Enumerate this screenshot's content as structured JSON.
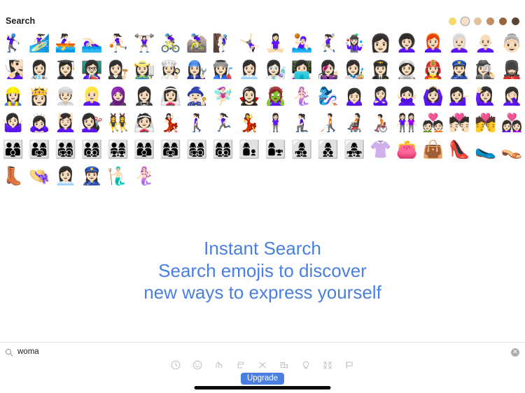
{
  "header": {
    "title": "Search",
    "skin_tones": [
      {
        "name": "default-yellow",
        "color": "#f4d96b",
        "selected": false
      },
      {
        "name": "light-skin-tone",
        "color": "#f6e0c8",
        "selected": true
      },
      {
        "name": "medium-light-skin-tone",
        "color": "#e2c39a",
        "selected": false
      },
      {
        "name": "medium-skin-tone",
        "color": "#bf8f63",
        "selected": false
      },
      {
        "name": "medium-dark-skin-tone",
        "color": "#96653f",
        "selected": false
      },
      {
        "name": "dark-skin-tone",
        "color": "#5c4433",
        "selected": false
      }
    ]
  },
  "grid": {
    "emojis": [
      "🏌🏻‍♀️",
      "🏄🏻‍♀️",
      "🚣🏻‍♀️",
      "🏊🏻‍♀️",
      "⛹🏻‍♀️",
      "🏋🏻‍♀️",
      "🚴🏻‍♀️",
      "🚵🏻‍♀️",
      "🧗🏻‍♀️",
      "🤸🏻‍♀️",
      "🧘🏻‍♀️",
      "🤽🏻‍♀️",
      "🤾🏻‍♀️",
      "🤹🏻‍♀️",
      "👩🏻",
      "👩🏻‍🦱",
      "👩🏻‍🦰",
      "👩🏻‍🦳",
      "👩🏻‍🦲",
      "👵🏻",
      "🧏🏻‍♀️",
      "👩🏻‍⚕️",
      "👩🏻‍🎓",
      "👩🏻‍🏫",
      "👩🏻‍⚖️",
      "👩🏻‍🌾",
      "👩🏻‍🍳",
      "👩🏻‍🔧",
      "👩🏻‍🏭",
      "👩🏻‍💼",
      "👩🏻‍🔬",
      "👩🏻‍💻",
      "👩🏻‍🎤",
      "👩🏻‍🎨",
      "👩🏻‍✈️",
      "👩🏻‍🚀",
      "👩🏻‍🚒",
      "👮🏻‍♀️",
      "🕵🏻‍♀️",
      "💂🏻‍♀️",
      "👷🏻‍♀️",
      "👸🏻",
      "👳🏻‍♀️",
      "👱🏻‍♀️",
      "🧕🏻",
      "🤵🏻‍♀️",
      "👰🏻‍♀️",
      "🧙🏻‍♀️",
      "🧚🏻‍♀️",
      "🧛🏻‍♀️",
      "🧟‍♀️",
      "🧜🏻‍♀️",
      "🧞‍♀️",
      "🙍🏻‍♀️",
      "🙎🏻‍♀️",
      "🙅🏻‍♀️",
      "🙆🏻‍♀️",
      "💁🏻‍♀️",
      "🙋🏻‍♀️",
      "🤦🏻‍♀️",
      "🤷🏻‍♀️",
      "🙇🏻‍♀️",
      "💆🏻‍♀️",
      "💇🏻‍♀️",
      "👯‍♀️",
      "👰🏻",
      "💃🏻",
      "🚶🏻‍♀️",
      "🏃🏻‍♀️",
      "💃",
      "🧍🏻‍♀️",
      "🧎🏻‍♀️",
      "🧑🏻‍🦯",
      "🧑🏻‍🦼",
      "🧑🏻‍🦽",
      "👭🏻",
      "💑🏻",
      "💏🏻",
      "💏",
      "👩🏻‍❤️‍👩🏻",
      "👨‍👩‍👦",
      "👨‍👩‍👧",
      "👨‍👩‍👧‍👦",
      "👨‍👩‍👦‍👦",
      "👨‍👩‍👧‍👧",
      "👩‍👩‍👦",
      "👩‍👩‍👧",
      "👩‍👩‍👧‍👦",
      "👩‍👩‍👦‍👦",
      "👩‍👦",
      "👩‍👧",
      "👩‍👧‍👦",
      "👩‍👦‍👦",
      "👩‍👧‍👧",
      "👚",
      "👛",
      "👜",
      "👠",
      "🥿",
      "👡",
      "👢",
      "👒",
      "👩🏻‍💼",
      "👮🏻‍♀️",
      "🧜🏻‍♂️",
      "🧜🏻‍♀️"
    ]
  },
  "promo": {
    "line1": "Instant Search",
    "line2": "Search emojis to discover",
    "line3": "new ways to express yourself",
    "color": "#4a7fe0"
  },
  "search": {
    "icon": "search-icon",
    "value": "woma",
    "placeholder": "Search",
    "clear_label": "✕"
  },
  "toolbar": {
    "items": [
      {
        "name": "recent-icon",
        "label": "Recently Used"
      },
      {
        "name": "smileys-icon",
        "label": "Smileys & People"
      },
      {
        "name": "animals-icon",
        "label": "Animals & Nature"
      },
      {
        "name": "food-icon",
        "label": "Food & Drink"
      },
      {
        "name": "activity-icon",
        "label": "Activity"
      },
      {
        "name": "travel-icon",
        "label": "Travel & Places"
      },
      {
        "name": "objects-icon",
        "label": "Objects"
      },
      {
        "name": "symbols-icon",
        "label": "Symbols"
      },
      {
        "name": "flags-icon",
        "label": "Flags"
      }
    ]
  },
  "upgrade": {
    "label": "Upgrade",
    "color": "#4a7fe0"
  }
}
